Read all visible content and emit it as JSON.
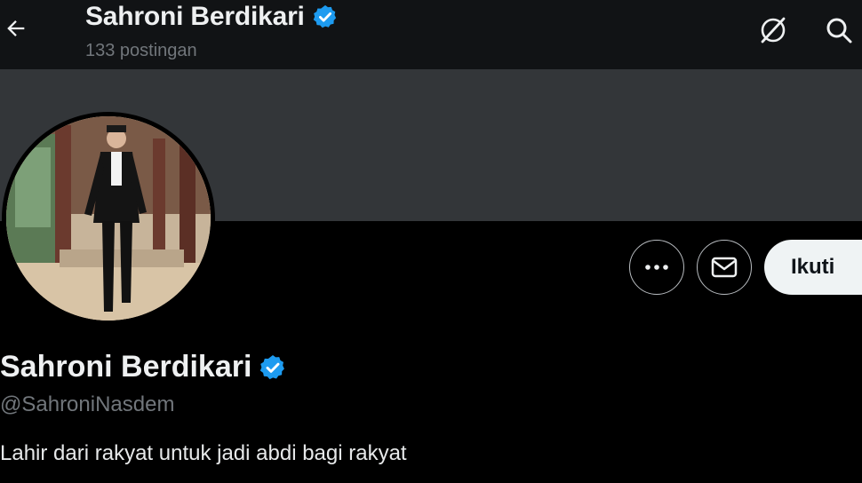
{
  "header": {
    "name": "Sahroni Berdikari",
    "post_count": "133 postingan",
    "icons": [
      "back-arrow-icon",
      "verified-badge-icon",
      "grok-icon",
      "search-icon"
    ]
  },
  "profile": {
    "display_name": "Sahroni Berdikari",
    "handle": "@SahroniNasdem",
    "bio": "Lahir dari rakyat untuk jadi abdi bagi rakyat",
    "verified": true
  },
  "actions": {
    "follow_label": "Ikuti",
    "icons": [
      "more-icon",
      "message-icon"
    ]
  },
  "colors": {
    "background": "#000000",
    "topbar": "#111315",
    "banner": "#333639",
    "verified": "#1d9bf0",
    "muted_text": "#71767b",
    "follow_button_bg": "#eff3f4"
  }
}
